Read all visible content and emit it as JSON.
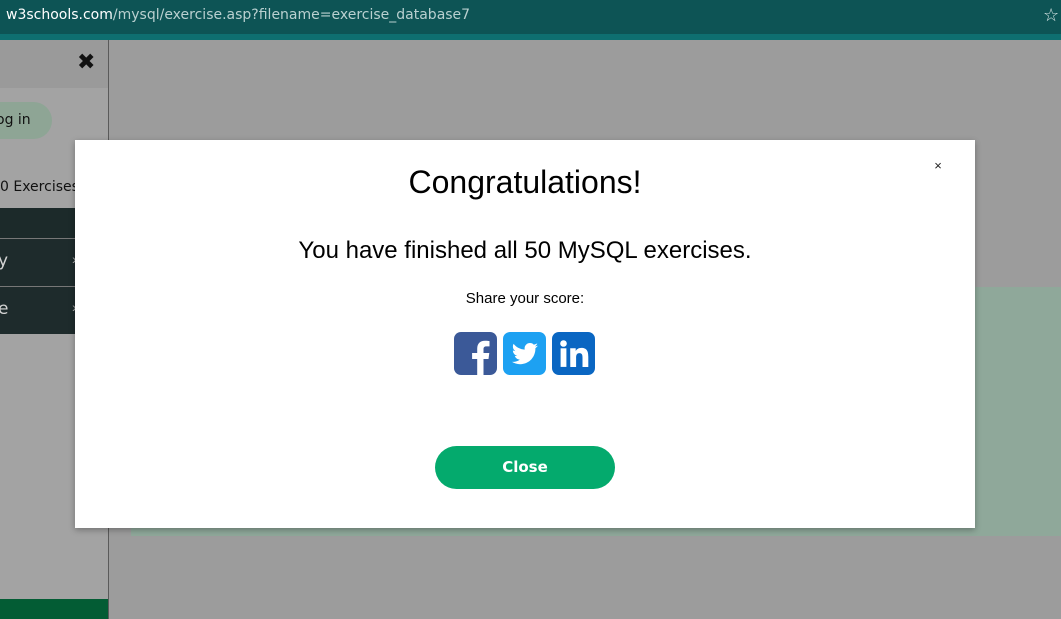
{
  "browser": {
    "url_domain": "w3schools.com",
    "url_path": "/mysql/exercise.asp?filename=exercise_database7",
    "star_icon": "star-icon"
  },
  "sidebar": {
    "close_icon": "close-icon",
    "login_label": "og in",
    "progress_label": "0 Exercises",
    "items": [
      {
        "label": "y"
      },
      {
        "label": "e"
      }
    ]
  },
  "modal": {
    "close_x": "×",
    "title": "Congratulations!",
    "message": "You have finished all 50 MySQL exercises.",
    "share_label": "Share your score:",
    "share_icons": [
      "facebook-icon",
      "twitter-icon",
      "linkedin-icon"
    ],
    "close_button_label": "Close"
  },
  "colors": {
    "url_bar": "#0d5455",
    "accent_green": "#04aa6d",
    "facebook": "#3b5998",
    "twitter": "#1da1f2",
    "linkedin": "#0a66c2"
  }
}
